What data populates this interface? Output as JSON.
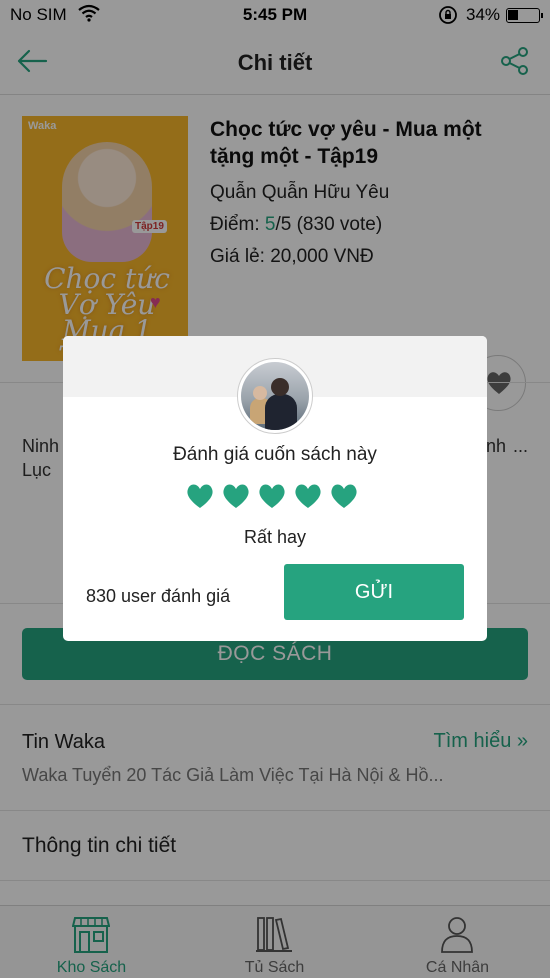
{
  "status_bar": {
    "carrier": "No SIM",
    "time": "5:45 PM",
    "battery_percent": "34%"
  },
  "nav": {
    "title": "Chi tiết"
  },
  "book": {
    "cover_brand": "Waka",
    "cover_tag": "Tập19",
    "cover_title": "Chọc tức Vợ Yêu Mua 1 Tặng 1",
    "title": "Chọc tức vợ yêu - Mua một tặng một - Tập19",
    "author": "Quẫn Quẫn Hữu Yêu",
    "score_label": "Điểm: ",
    "score_value": "5",
    "score_rest": "/5 (830 vote)",
    "price": "Giá lẻ: 20,000 VNĐ"
  },
  "description": "Ninh ... n vô cùng ... hư Ý quyề ... o cô nguy ... này chính ... Lục",
  "read_button": "ĐỌC SÁCH",
  "news": {
    "label": "Tin Waka",
    "more": "Tìm hiểu »",
    "headline": "Waka Tuyển 20 Tác Giả Làm Việc Tại Hà Nội & Hồ..."
  },
  "details_label": "Thông tin chi tiết",
  "tabs": [
    {
      "label": "Kho Sách",
      "icon": "store-icon",
      "active": true
    },
    {
      "label": "Tủ Sách",
      "icon": "bookshelf-icon",
      "active": false
    },
    {
      "label": "Cá Nhân",
      "icon": "user-icon",
      "active": false
    }
  ],
  "dialog": {
    "title": "Đánh giá cuốn sách này",
    "rating": 5,
    "rating_max": 5,
    "rating_label": "Rất hay",
    "user_count": "830 user đánh giá",
    "send_button": "GỬI"
  },
  "colors": {
    "accent": "#26a37f",
    "cover": "#f7b62a",
    "overlay": "rgba(0,0,0,0.40)"
  }
}
